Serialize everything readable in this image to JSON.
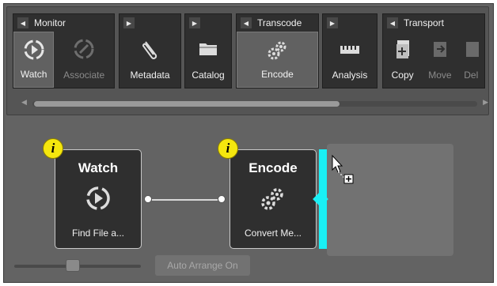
{
  "toolbar": {
    "groups": [
      {
        "title": "Monitor",
        "buttons": [
          {
            "label": "Watch",
            "icon": "watch-icon",
            "enabled": true
          },
          {
            "label": "Associate",
            "icon": "associate-icon",
            "enabled": false
          }
        ]
      },
      {
        "title": "",
        "buttons": [
          {
            "label": "Metadata",
            "icon": "paperclip-icon",
            "enabled": true
          }
        ]
      },
      {
        "title": "",
        "buttons": [
          {
            "label": "Catalog",
            "icon": "folder-icon",
            "enabled": true
          }
        ]
      },
      {
        "title": "Transcode",
        "buttons": [
          {
            "label": "Encode",
            "icon": "gears-icon",
            "enabled": true
          }
        ]
      },
      {
        "title": "",
        "buttons": [
          {
            "label": "Analysis",
            "icon": "analysis-icon",
            "enabled": true
          }
        ]
      },
      {
        "title": "Transport",
        "buttons": [
          {
            "label": "Copy",
            "icon": "copy-icon",
            "enabled": true
          },
          {
            "label": "Move",
            "icon": "move-icon",
            "enabled": false
          },
          {
            "label": "Del",
            "icon": "delete-icon",
            "enabled": false
          }
        ]
      }
    ]
  },
  "canvas": {
    "nodes": [
      {
        "title": "Watch",
        "description": "Find File a...",
        "icon": "watch-icon",
        "badge": "i"
      },
      {
        "title": "Encode",
        "description": "Convert Me...",
        "icon": "gears-icon",
        "badge": "i"
      }
    ],
    "auto_arrange_label": "Auto Arrange On",
    "zoom_level": 0.5
  },
  "colors": {
    "accent_drop": "#19f0f5",
    "info_badge": "#f5e70e",
    "node_bg": "#2f2f2f"
  }
}
